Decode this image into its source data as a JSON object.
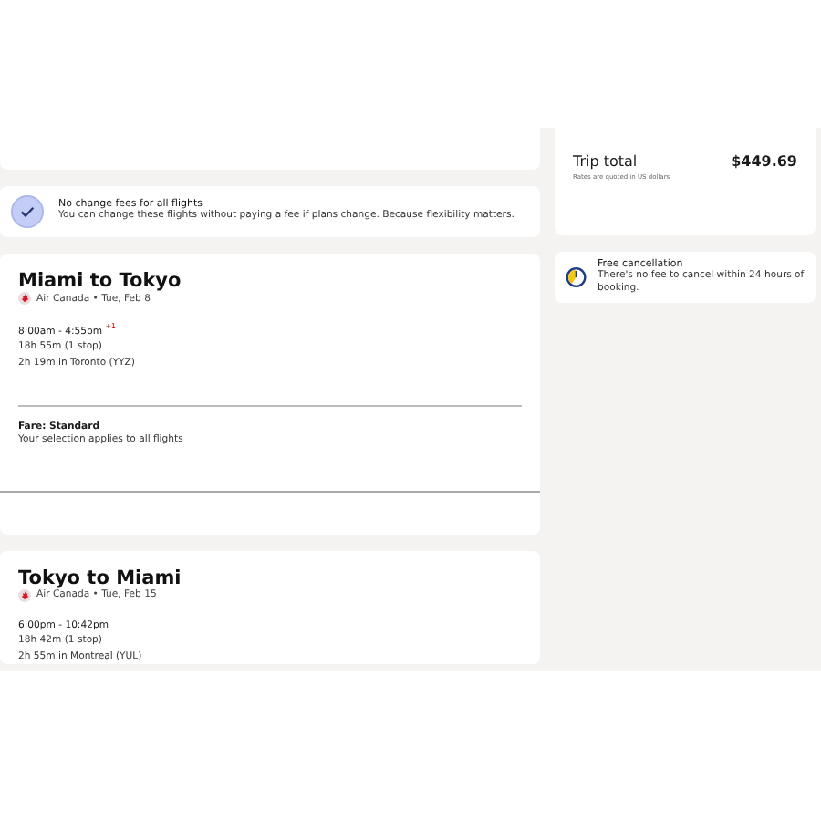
{
  "notice": {
    "title": "No change fees for all flights",
    "text": "You can change these flights without paying a fee if plans change. Because flexibility matters."
  },
  "flights": [
    {
      "route": "Miami to Tokyo",
      "airline": "Air Canada • Tue, Feb 8",
      "times": "8:00am - 4:55pm $^{+1}$",
      "duration": "18h 55m (1 stop)",
      "layover": "2h 19m in Toronto (YYZ)",
      "fare": "Fare: Standard",
      "fare_note": "Your selection applies to all flights"
    },
    {
      "route": "Tokyo to Miami",
      "airline": "Air Canada • Tue, Feb 15",
      "times": "6:00pm - 10:42pm",
      "duration": "18h 42m (1 stop)",
      "layover": "2h 55m in Montreal (YUL)"
    }
  ],
  "trip_total": {
    "label": "Trip total",
    "amount": "$449.69",
    "note": "Rates are quoted in US dollars"
  },
  "cancellation": {
    "title": "Free cancellation",
    "text": "There's no fee to cancel within 24 hours of booking."
  }
}
